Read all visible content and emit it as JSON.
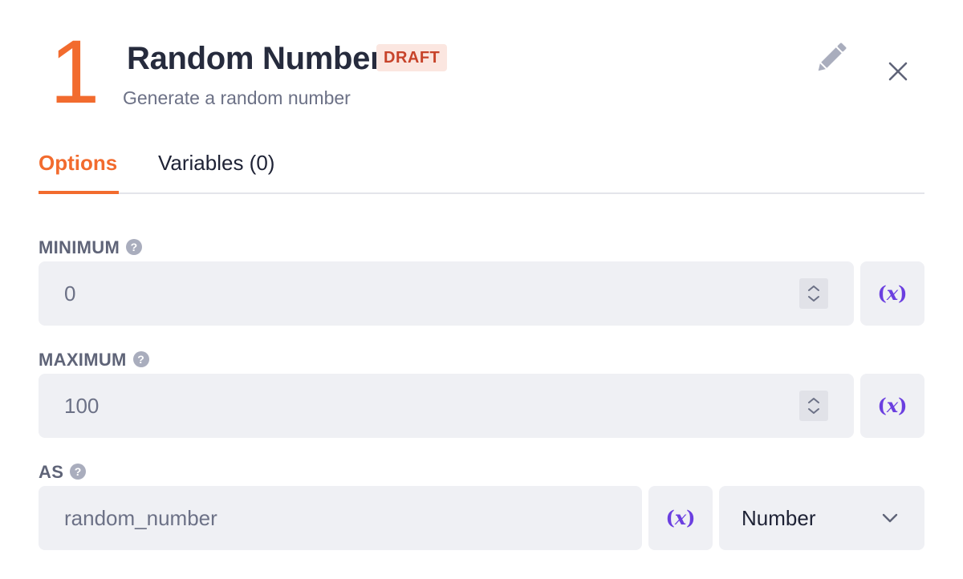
{
  "step": {
    "number": "1"
  },
  "header": {
    "title": "Random Number",
    "badge": "DRAFT",
    "subtitle": "Generate a random number"
  },
  "tabs": [
    {
      "label": "Options",
      "active": true
    },
    {
      "label": "Variables (0)",
      "active": false
    }
  ],
  "fields": {
    "minimum": {
      "label": "MINIMUM",
      "value": "0",
      "help": "?"
    },
    "maximum": {
      "label": "MAXIMUM",
      "value": "100",
      "help": "?"
    },
    "as": {
      "label": "AS",
      "value": "random_number",
      "help": "?",
      "type_selected": "Number"
    }
  },
  "variable_button": {
    "open": "(",
    "x": "x",
    "close": ")"
  },
  "icons": {
    "edit": "pencil-icon",
    "close": "close-icon",
    "help": "question-circle-icon",
    "stepper": "stepper-icon",
    "dropdown": "chevron-down-icon"
  },
  "colors": {
    "accent": "#f26b2e",
    "variable": "#6b3fe0",
    "badge_bg": "#fbe6e0",
    "badge_text": "#c7432a"
  }
}
